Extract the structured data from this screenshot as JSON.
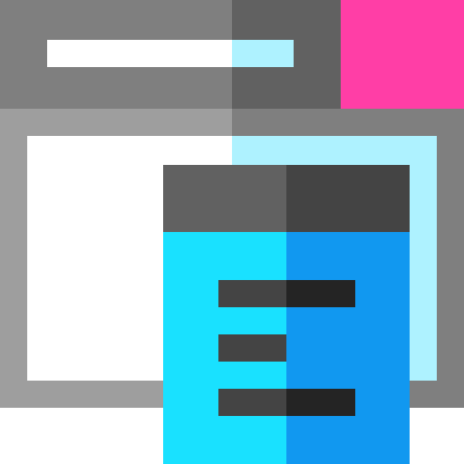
{
  "app": {
    "name": "",
    "icon": "web-document-icon"
  },
  "browser_window": {
    "title": "",
    "address_text": "",
    "colors": {
      "title_bar_light": "#7f7f7f",
      "title_bar_dark": "#616161",
      "close_button": "#ff3ea6",
      "frame_light": "#9e9e9e",
      "frame_dark": "#7f7f7f",
      "content_light": "#ffffff",
      "content_highlight": "#aef2ff"
    }
  },
  "document": {
    "lines": [
      "",
      "",
      ""
    ],
    "colors": {
      "header_light": "#616161",
      "header_dark": "#444444",
      "body_light": "#19e1ff",
      "body_dark": "#1198f0",
      "line_light": "#444444",
      "line_dark": "#242424"
    }
  }
}
